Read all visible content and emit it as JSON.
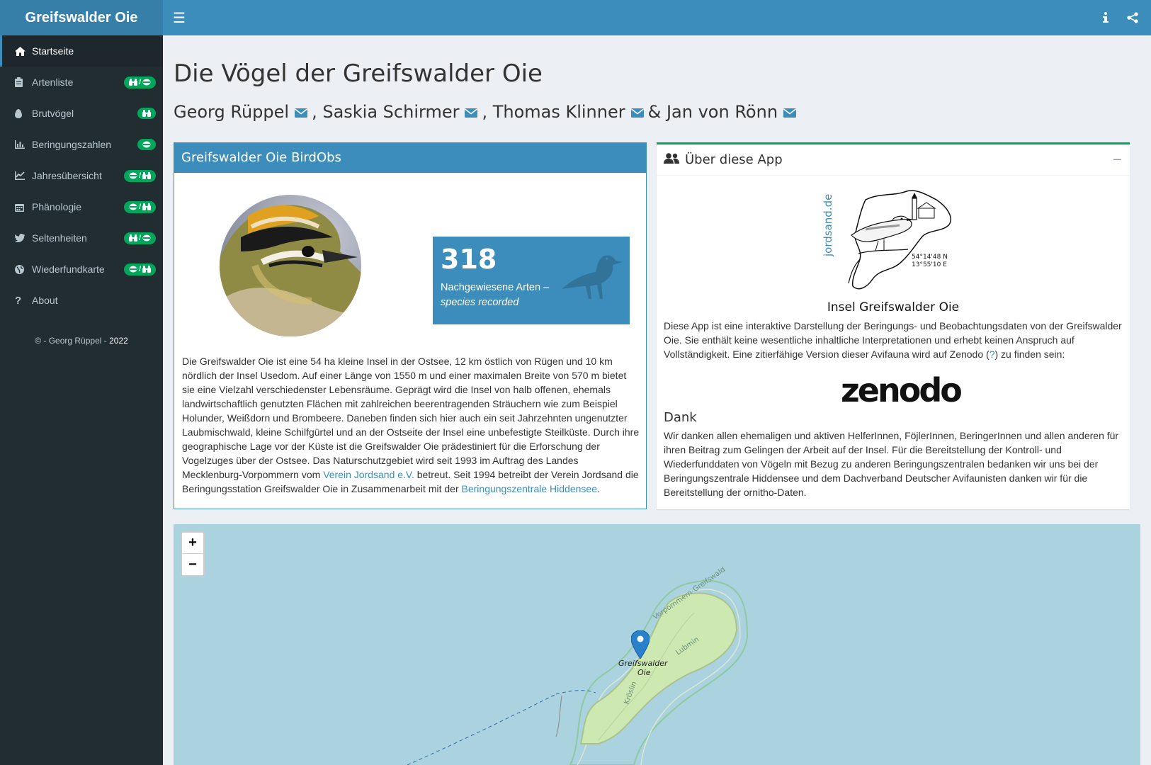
{
  "app": {
    "brand": "Greifswalder Oie"
  },
  "topbar": {
    "menu_icon": "bars-icon",
    "info_icon": "info-icon",
    "share_icon": "share-icon"
  },
  "sidebar": {
    "items": [
      {
        "label": "Startseite",
        "icon": "home-icon",
        "badge": ""
      },
      {
        "label": "Artenliste",
        "icon": "clipboard-icon",
        "badge": "binoculars/ring"
      },
      {
        "label": "Brutvögel",
        "icon": "egg-icon",
        "badge": "binoculars"
      },
      {
        "label": "Beringungszahlen",
        "icon": "bar-chart-icon",
        "badge": "ring"
      },
      {
        "label": "Jahresübersicht",
        "icon": "line-chart-icon",
        "badge": "ring/binoculars"
      },
      {
        "label": "Phänologie",
        "icon": "calendar-icon",
        "badge": "ring/binoculars"
      },
      {
        "label": "Seltenheiten",
        "icon": "twitter-bird-icon",
        "badge": "binoculars/ring"
      },
      {
        "label": "Wiederfundkarte",
        "icon": "globe-icon",
        "badge": "ring/binoculars"
      },
      {
        "label": "About",
        "icon": "question-icon",
        "badge": ""
      }
    ],
    "copyright_prefix": "© - Georg Rüppel - ",
    "copyright_year": "2022"
  },
  "main": {
    "title": "Die Vögel der Greifswalder Oie",
    "authors": {
      "a1": "Georg Rüppel",
      "sep1": ", Saskia Schirmer",
      "sep2": ", Thomas Klinner",
      "sep3": "& Jan von Rönn"
    }
  },
  "birdobs": {
    "header": "Greifswalder Oie BirdObs",
    "species_count": "318",
    "species_label": "Nachgewiesene Arten –",
    "species_label_en": "species recorded",
    "text_before_link1": "Die Greifswalder Oie ist eine 54 ha kleine Insel in der Ostsee, 12 km östlich von Rügen und 10 km nördlich der Insel Usedom. Auf einer Länge von 1550 m und einer maximalen Breite von 570 m bietet sie eine Vielzahl verschiedenster Lebensräume. Geprägt wird die Insel von halb offenen, ehemals landwirtschaftlich genutzten Flächen mit zahlreichen beerentragenden Sträuchern wie zum Beispiel Holunder, Weißdorn und Brombeere. Daneben finden sich hier auch ein seit Jahrzehnten ungenutzter Laubmischwald, kleine Schilfgürtel und an der Ostseite der Insel eine unbefestigte Steilküste. Durch ihre geographische Lage vor der Küste ist die Greifswalder Oie prädestiniert für die Erforschung der Vogelzuges über der Ostsee. Das Naturschutzgebiet wird seit 1993 im Auftrag des Landes Mecklenburg-Vorpommern vom ",
    "link1": "Verein Jordsand e.V.",
    "text_between": " betreut. Seit 1994 betreibt der Verein Jordsand die Beringungsstation Greifswalder Oie in Zusammenarbeit mit der ",
    "link2": "Beringungszentrale Hiddensee",
    "text_end": "."
  },
  "about": {
    "header": "Über diese App",
    "logo_side_text": "jordsand.de",
    "logo_coord_n": "54°14'48 N",
    "logo_coord_e": "13°55'10  E",
    "logo_caption": "Insel Greifswalder Oie",
    "text1_before": "Diese App ist eine interaktive Darstellung der Beringungs- und Beobachtungsdaten von der Greifswalder Oie. Sie enthält keine wesentliche inhaltliche Interpretationen und erhebt keinen Anspruch auf Vollständigkeit. Eine zitierfähige Version dieser Avifauna wird auf Zenodo (",
    "text1_link": "?",
    "text1_after": ") zu finden sein:",
    "zenodo": "zenodo",
    "dank_title": "Dank",
    "dank_text": "Wir danken allen ehemaligen und aktiven HelferInnen, FöjlerInnen, BeringerInnen und allen anderen für ihren Beitrag zum Gelingen der Arbeit auf der Insel. Für die Bereitstellung der Kontroll- und Wiederfunddaten von Vögeln mit Bezug zu anderen Beringungszentralen bedanken wir uns bei der Beringungszentrale Hiddensee und dem Dachverband Deutscher Avifaunisten danken wir für die Bereitstellung der ornitho-Daten."
  },
  "map": {
    "zoom_in": "+",
    "zoom_out": "−",
    "marker_label_1": "Greifswalder",
    "marker_label_2": "Oie",
    "road_1": "Vorpommern-Greifswald",
    "road_2": "Lubmin",
    "road_3": "Kröslin"
  }
}
